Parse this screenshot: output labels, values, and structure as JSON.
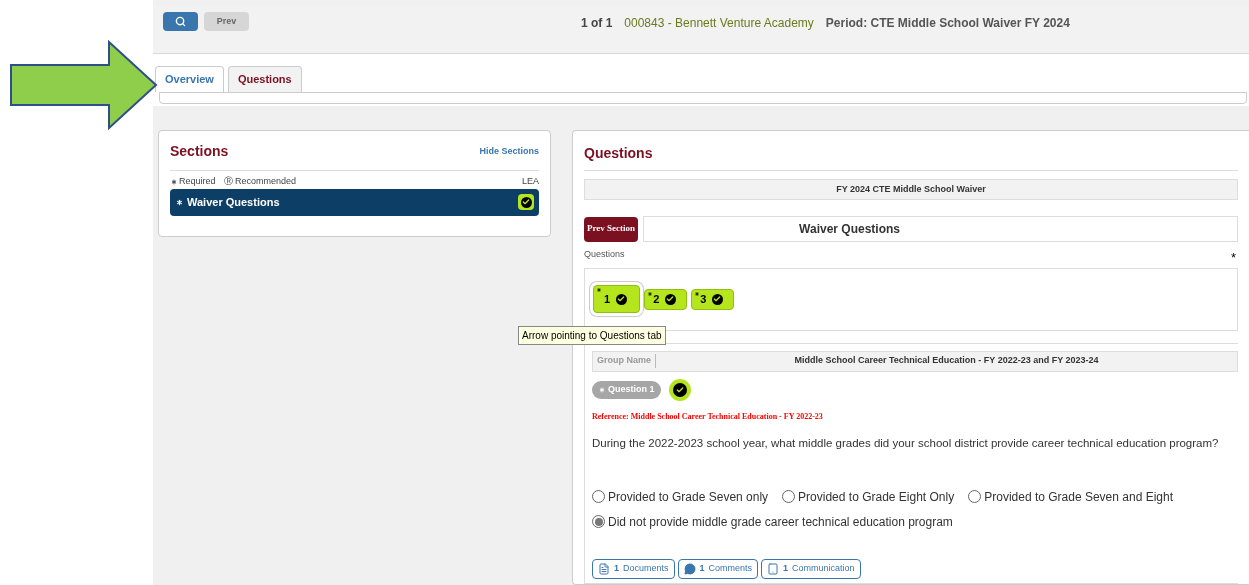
{
  "toolbar": {
    "prev": "Prev",
    "pager": "1 of 1",
    "organization": "000843 - Bennett Venture Academy",
    "period": "Period: CTE Middle School Waiver FY 2024"
  },
  "tabs": [
    {
      "label": "Overview",
      "selected": true
    },
    {
      "label": "Questions",
      "selected": false
    }
  ],
  "sections": {
    "title": "Sections",
    "hide_link": "Hide Sections",
    "legend_required": "Required",
    "legend_recommended": "Recommended",
    "recommended_mark": "Ⓡ",
    "column": "LEA",
    "items": [
      {
        "label": "Waiver Questions",
        "selected": true,
        "complete": true
      }
    ]
  },
  "questions_panel": {
    "title": "Questions",
    "banner": "FY 2024 CTE Middle School Waiver",
    "prev_section": "Prev Section",
    "section_title": "Waiver Questions",
    "questions_label": "Questions",
    "required_mark": "*",
    "question_buttons": [
      {
        "label": "1",
        "selected": true,
        "complete": true
      },
      {
        "label": "2",
        "selected": false,
        "complete": true
      },
      {
        "label": "3",
        "selected": false,
        "complete": true
      }
    ],
    "group_label": "Group Name",
    "group_name": "Middle School Career Technical Education - FY 2022-23 and FY 2023-24",
    "question_badge": "Question 1",
    "question_complete": true,
    "reference": "Reference: Middle School Career Technical Education - FY 2022-23",
    "question_text": "During the 2022-2023 school year, what middle grades did your school district provide career technical education program?",
    "options": [
      {
        "label": "Provided to Grade Seven only",
        "selected": false
      },
      {
        "label": "Provided to Grade Eight Only",
        "selected": false
      },
      {
        "label": "Provided to Grade Seven and Eight",
        "selected": false
      },
      {
        "label": "Did not provide middle grade career technical education program",
        "selected": true
      }
    ],
    "attachments": [
      {
        "kind": "documents",
        "count": "1",
        "label": "Documents"
      },
      {
        "kind": "comments",
        "count": "1",
        "label": "Comments"
      },
      {
        "kind": "communication",
        "count": "1",
        "label": "Communication"
      }
    ]
  },
  "tooltip": "Arrow pointing to Questions tab"
}
